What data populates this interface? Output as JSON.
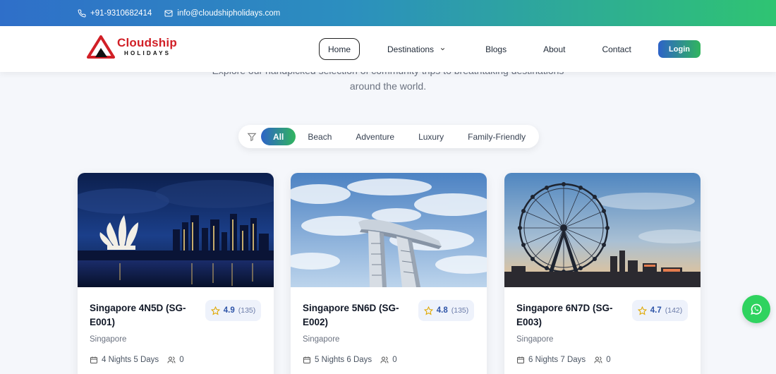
{
  "topbar": {
    "phone": "+91-9310682414",
    "email": "info@cloudshipholidays.com"
  },
  "brand": {
    "name": "Cloudship",
    "tagline": "HOLIDAYS",
    "mark_letter": "C",
    "color": "#d11f26"
  },
  "nav": {
    "home": "Home",
    "destinations": "Destinations",
    "blogs": "Blogs",
    "about": "About",
    "contact": "Contact",
    "login": "Login"
  },
  "hero": {
    "line1": "Explore our handpicked selection of community trips to breathtaking destinations",
    "line2": "around the world."
  },
  "filters": [
    "All",
    "Beach",
    "Adventure",
    "Luxury",
    "Family-Friendly"
  ],
  "cards": [
    {
      "title": "Singapore 4N5D (SG-E001)",
      "rating": "4.9",
      "reviews": "(135)",
      "location": "Singapore",
      "duration": "4 Nights 5 Days",
      "travellers": "0",
      "image": "Marina Bay skyline at night"
    },
    {
      "title": "Singapore 5N6D (SG-E002)",
      "rating": "4.8",
      "reviews": "(135)",
      "location": "Singapore",
      "duration": "5 Nights 6 Days",
      "travellers": "0",
      "image": "Marina Bay Sands against cloudy sky"
    },
    {
      "title": "Singapore 6N7D (SG-E003)",
      "rating": "4.7",
      "reviews": "(142)",
      "location": "Singapore",
      "duration": "6 Nights 7 Days",
      "travellers": "0",
      "image": "Singapore Flyer at sunset"
    }
  ],
  "colors": {
    "accent_blue": "#2e63c8",
    "accent_green": "#31b55e",
    "rating_text": "#2f55a8",
    "whatsapp": "#2fd35f"
  }
}
